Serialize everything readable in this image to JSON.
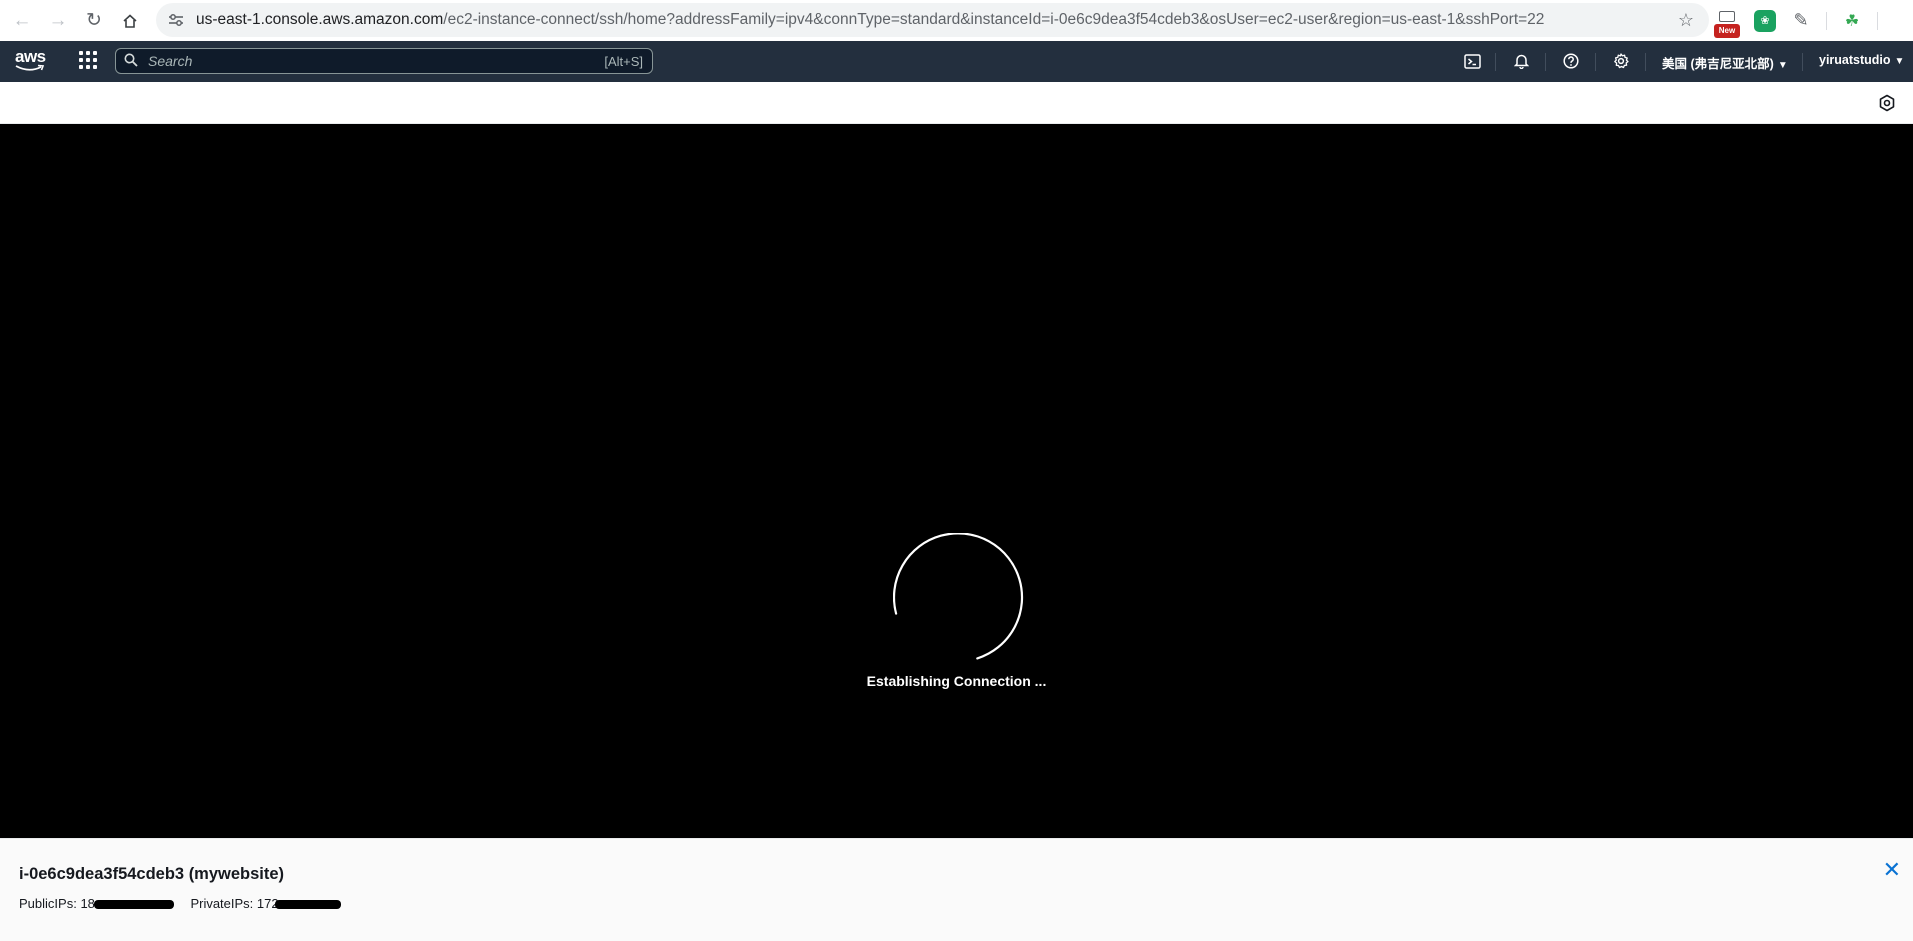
{
  "browser": {
    "url_host": "us-east-1.console.aws.amazon.com",
    "url_path": "/ec2-instance-connect/ssh/home?addressFamily=ipv4&connType=standard&instanceId=i-0e6c9dea3f54cdeb3&osUser=ec2-user&region=us-east-1&sshPort=22",
    "extension_badge": "New"
  },
  "aws_nav": {
    "logo_text": "aws",
    "search_placeholder": "Search",
    "search_shortcut": "[Alt+S]",
    "region": "美国 (弗吉尼亚北部)",
    "account": "yiruatstudio"
  },
  "terminal": {
    "status": "Establishing Connection ..."
  },
  "footer": {
    "instance_title": "i-0e6c9dea3f54cdeb3 (mywebsite)",
    "public_ips_label": "PublicIPs:",
    "public_ips_value": "18",
    "private_ips_label": "PrivateIPs:",
    "private_ips_value": "172"
  }
}
